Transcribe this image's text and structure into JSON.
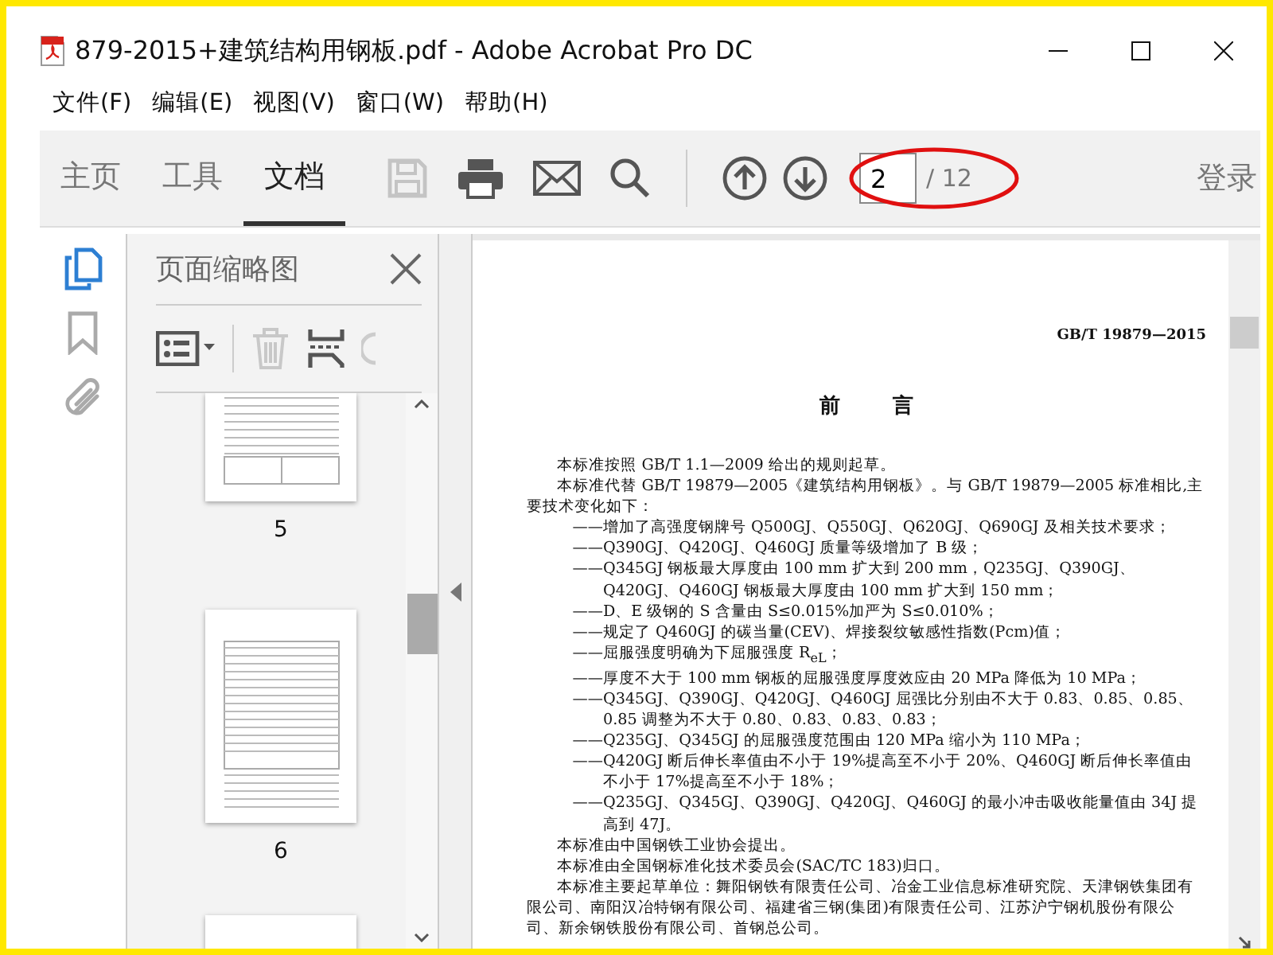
{
  "window": {
    "title": "879-2015+建筑结构用钢板.pdf - Adobe Acrobat Pro DC"
  },
  "menu": [
    {
      "label": "文件(F)"
    },
    {
      "label": "编辑(E)"
    },
    {
      "label": "视图(V)"
    },
    {
      "label": "窗口(W)"
    },
    {
      "label": "帮助(H)"
    }
  ],
  "tabs": [
    {
      "label": "主页",
      "selected": false
    },
    {
      "label": "工具",
      "selected": false
    },
    {
      "label": "文档",
      "selected": true
    }
  ],
  "toolbar": {
    "save_disabled": true,
    "page_number": "2",
    "page_total": "/ 12",
    "sign_in": "登录"
  },
  "side_rail": [
    {
      "kind": "pages",
      "selected": true
    },
    {
      "kind": "bookmarks",
      "selected": false
    },
    {
      "kind": "attachments",
      "selected": false
    }
  ],
  "thumbnail_panel": {
    "title": "页面缩略图",
    "delete_disabled": true,
    "pages": [
      {
        "kind": "bottom-cut",
        "label": "5"
      },
      {
        "kind": "whole",
        "label": "6"
      },
      {
        "kind": "top-cut"
      }
    ]
  },
  "document": {
    "header": "GB/T 19879—2015",
    "title": "前 言",
    "paragraphs": [
      {
        "kind": "para",
        "text": "本标准按照 GB/T 1.1—2009 给出的规则起草。"
      },
      {
        "kind": "para",
        "text": "本标准代替 GB/T 19879—2005《建筑结构用钢板》。与 GB/T 19879—2005 标准相比,主要技术变化如下："
      },
      {
        "kind": "dash",
        "text": "——增加了高强度钢牌号 Q500GJ、Q550GJ、Q620GJ、Q690GJ 及相关技术要求；"
      },
      {
        "kind": "dash",
        "text": "——Q390GJ、Q420GJ、Q460GJ 质量等级增加了 B 级；"
      },
      {
        "kind": "dash",
        "text": "——Q345GJ 钢板最大厚度由 100 mm 扩大到 200 mm，Q235GJ、Q390GJ、Q420GJ、Q460GJ 钢板最大厚度由 100 mm 扩大到 150 mm；"
      },
      {
        "kind": "dash",
        "text": "——D、E 级钢的 S 含量由 S≤0.015%加严为 S≤0.010%；"
      },
      {
        "kind": "dash",
        "text": "——规定了 Q460GJ 的碳当量(CEV)、焊接裂纹敏感性指数(Pcm)值；"
      },
      {
        "kind": "dash",
        "text": "——屈服强度明确为下屈服强度 R$_{eL}$；"
      },
      {
        "kind": "dash",
        "text": "——厚度不大于 100 mm 钢板的屈服强度厚度效应由 20 MPa 降低为 10 MPa；"
      },
      {
        "kind": "dash",
        "text": "——Q345GJ、Q390GJ、Q420GJ、Q460GJ 屈强比分别由不大于 0.83、0.85、0.85、0.85 调整为不大于 0.80、0.83、0.83、0.83；"
      },
      {
        "kind": "dash",
        "text": "——Q235GJ、Q345GJ 的屈服强度范围由 120 MPa 缩小为 110 MPa；"
      },
      {
        "kind": "dash",
        "text": "——Q420GJ 断后伸长率值由不小于 19%提高至不小于 20%、Q460GJ 断后伸长率值由不小于 17%提高至不小于 18%；"
      },
      {
        "kind": "dash",
        "text": "——Q235GJ、Q345GJ、Q390GJ、Q420GJ、Q460GJ 的最小冲击吸收能量值由 34J 提高到 47J。"
      },
      {
        "kind": "para",
        "text": "本标准由中国钢铁工业协会提出。"
      },
      {
        "kind": "para",
        "text": "本标准由全国钢标准化技术委员会(SAC/TC 183)归口。"
      },
      {
        "kind": "para",
        "text": "本标准主要起草单位：舞阳钢铁有限责任公司、冶金工业信息标准研究院、天津钢铁集团有限公司、南阳汉冶特钢有限公司、福建省三钢(集团)有限责任公司、江苏沪宁钢机股份有限公司、新余钢铁股份有限公司、首钢总公司。"
      }
    ]
  }
}
